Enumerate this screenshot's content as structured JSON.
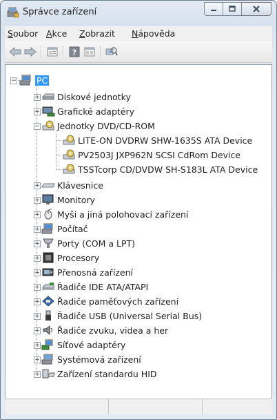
{
  "window": {
    "title": "Správce zařízení",
    "caption_buttons": [
      "minimize",
      "maximize",
      "close"
    ]
  },
  "menu": [
    {
      "accel": "S",
      "rest": "oubor"
    },
    {
      "accel": "A",
      "rest": "kce"
    },
    {
      "accel": "Z",
      "rest": "obrazit"
    },
    {
      "accel": "N",
      "rest": "ápověda"
    }
  ],
  "toolbar": {
    "icons": [
      "back-arrow-icon",
      "forward-arrow-icon",
      "properties-icon",
      "help-icon",
      "show-hide-console-tree-icon",
      "scan-hardware-icon"
    ]
  },
  "tree": {
    "root": "PC",
    "items": [
      {
        "label": "Diskové jednotky",
        "icon": "disk-drive-icon",
        "expanded": false
      },
      {
        "label": "Grafické adaptéry",
        "icon": "display-adapter-icon",
        "expanded": false
      },
      {
        "label": "Jednotky DVD/CD-ROM",
        "icon": "dvd-drive-icon",
        "expanded": true,
        "children": [
          "LITE-ON DVDRW SHW-1635S ATA Device",
          "PV2503J JXP962N SCSI CdRom Device",
          "TSSTcorp CD/DVDW SH-S183L ATA Device"
        ]
      },
      {
        "label": "Klávesnice",
        "icon": "keyboard-icon",
        "expanded": false
      },
      {
        "label": "Monitory",
        "icon": "monitor-icon",
        "expanded": false
      },
      {
        "label": "Myši a jiná polohovací zařízení",
        "icon": "mouse-icon",
        "expanded": false
      },
      {
        "label": "Počítač",
        "icon": "computer-icon",
        "expanded": false
      },
      {
        "label": "Porty (COM a LPT)",
        "icon": "port-icon",
        "expanded": false
      },
      {
        "label": "Procesory",
        "icon": "processor-icon",
        "expanded": false
      },
      {
        "label": "Přenosná zařízení",
        "icon": "portable-device-icon",
        "expanded": false
      },
      {
        "label": "Řadiče IDE ATA/ATAPI",
        "icon": "ide-controller-icon",
        "expanded": false
      },
      {
        "label": "Řadiče paměťových zařízení",
        "icon": "storage-controller-icon",
        "expanded": false
      },
      {
        "label": "Řadiče USB (Universal Serial Bus)",
        "icon": "usb-controller-icon",
        "expanded": false
      },
      {
        "label": "Řadiče zvuku, videa a her",
        "icon": "sound-icon",
        "expanded": false
      },
      {
        "label": "Síťové adaptéry",
        "icon": "network-adapter-icon",
        "expanded": false
      },
      {
        "label": "Systémová zařízení",
        "icon": "system-device-icon",
        "expanded": false
      },
      {
        "label": "Zařízení standardu HID",
        "icon": "hid-icon",
        "expanded": false
      }
    ]
  },
  "colors": {
    "selection": "#3399ff",
    "frame": "#dce6f1"
  }
}
